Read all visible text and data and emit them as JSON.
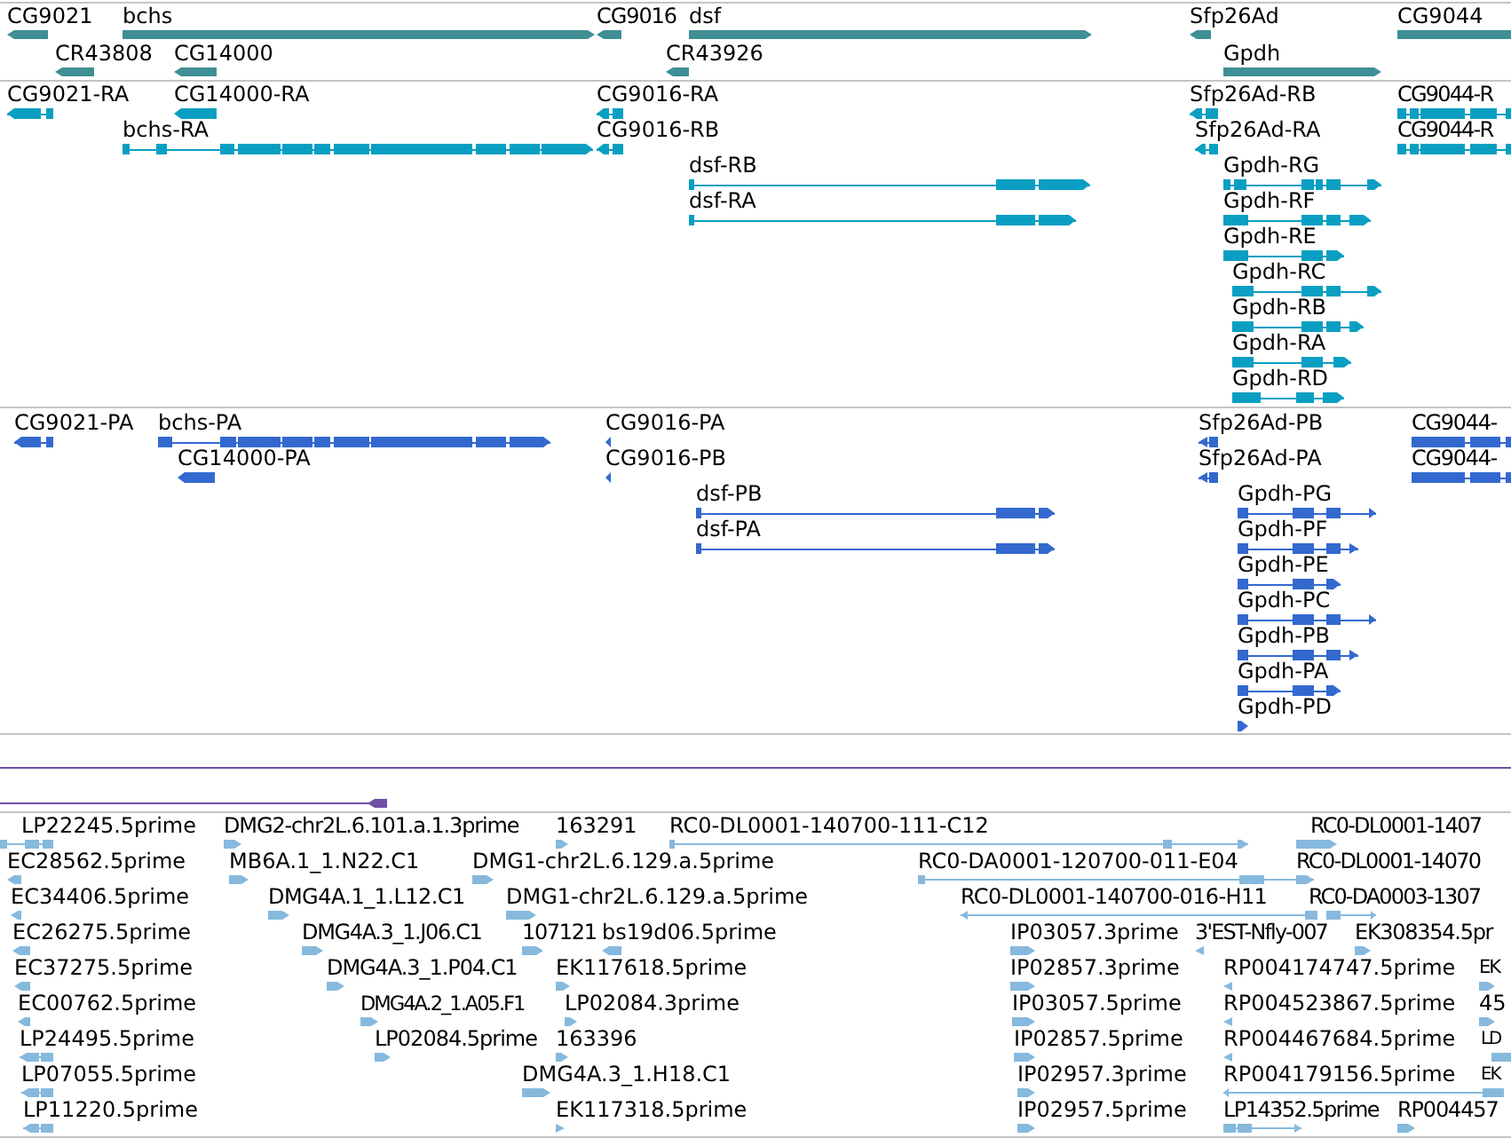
{
  "tracks": [
    {
      "kind": "gene",
      "features": [
        {
          "label": "CG9021",
          "reverse": true
        },
        {
          "label": "bchs",
          "reverse": false
        },
        {
          "label": "CG9016",
          "reverse": true
        },
        {
          "label": "dsf",
          "reverse": false
        },
        {
          "label": "Sfp26Ad",
          "reverse": true
        },
        {
          "label": "CG9044",
          "reverse": false
        },
        {
          "label": "CR43808",
          "reverse": true
        },
        {
          "label": "CG14000",
          "reverse": true
        },
        {
          "label": "CR43926",
          "reverse": true
        },
        {
          "label": "Gpdh",
          "reverse": false
        }
      ]
    },
    {
      "kind": "transcript",
      "features": [
        {
          "label": "CG9021-RA",
          "reverse": true
        },
        {
          "label": "CG14000-RA",
          "reverse": true
        },
        {
          "label": "CG9016-RA",
          "reverse": true
        },
        {
          "label": "Sfp26Ad-RB",
          "reverse": true
        },
        {
          "label": "CG9044-R",
          "reverse": false
        },
        {
          "label": "bchs-RA",
          "reverse": false
        },
        {
          "label": "CG9016-RB",
          "reverse": true
        },
        {
          "label": "Sfp26Ad-RA",
          "reverse": true
        },
        {
          "label": "CG9044-R",
          "reverse": false
        },
        {
          "label": "dsf-RB",
          "reverse": false
        },
        {
          "label": "Gpdh-RG",
          "reverse": false
        },
        {
          "label": "dsf-RA",
          "reverse": false
        },
        {
          "label": "Gpdh-RF",
          "reverse": false
        },
        {
          "label": "Gpdh-RE",
          "reverse": false
        },
        {
          "label": "Gpdh-RC",
          "reverse": false
        },
        {
          "label": "Gpdh-RB",
          "reverse": false
        },
        {
          "label": "Gpdh-RA",
          "reverse": false
        },
        {
          "label": "Gpdh-RD",
          "reverse": false
        }
      ]
    },
    {
      "kind": "protein",
      "features": [
        {
          "label": "CG9021-PA",
          "reverse": true
        },
        {
          "label": "bchs-PA",
          "reverse": false
        },
        {
          "label": "CG9016-PA",
          "reverse": true
        },
        {
          "label": "Sfp26Ad-PB",
          "reverse": true
        },
        {
          "label": "CG9044-",
          "reverse": false
        },
        {
          "label": "CG14000-PA",
          "reverse": true
        },
        {
          "label": "CG9016-PB",
          "reverse": true
        },
        {
          "label": "Sfp26Ad-PA",
          "reverse": true
        },
        {
          "label": "CG9044-",
          "reverse": false
        },
        {
          "label": "dsf-PB",
          "reverse": false
        },
        {
          "label": "Gpdh-PG",
          "reverse": false
        },
        {
          "label": "dsf-PA",
          "reverse": false
        },
        {
          "label": "Gpdh-PF",
          "reverse": false
        },
        {
          "label": "Gpdh-PE",
          "reverse": false
        },
        {
          "label": "Gpdh-PC",
          "reverse": false
        },
        {
          "label": "Gpdh-PB",
          "reverse": false
        },
        {
          "label": "Gpdh-PA",
          "reverse": false
        },
        {
          "label": "Gpdh-PD",
          "reverse": false
        }
      ]
    },
    {
      "kind": "line",
      "lines": [
        {
          "kind": "span"
        },
        {
          "kind": "segment"
        }
      ]
    },
    {
      "kind": "est",
      "features": [
        {
          "label": "LP22245.5prime",
          "reverse": true
        },
        {
          "label": "DMG2-chr2L.6.101.a.1.3prime",
          "reverse": false
        },
        {
          "label": "163291",
          "reverse": false
        },
        {
          "label": "RC0-DL0001-140700-111-C12",
          "reverse": false
        },
        {
          "label": "RC0-DL0001-1407",
          "reverse": false
        },
        {
          "label": "EC28562.5prime",
          "reverse": true
        },
        {
          "label": "MB6A.1_1.N22.C1",
          "reverse": false
        },
        {
          "label": "DMG1-chr2L.6.129.a.5prime",
          "reverse": false
        },
        {
          "label": "RC0-DA0001-120700-011-E04",
          "reverse": false
        },
        {
          "label": "RC0-DL0001-14070"
        },
        {
          "label": "EC34406.5prime",
          "reverse": true
        },
        {
          "label": "DMG4A.1_1.L12.C1",
          "reverse": false
        },
        {
          "label": "DMG1-chr2L.6.129.a.5prime",
          "reverse": false
        },
        {
          "label": "RC0-DL0001-140700-016-H11",
          "reverse": true
        },
        {
          "label": "RC0-DA0003-1307",
          "reverse": false
        },
        {
          "label": "EC26275.5prime",
          "reverse": true
        },
        {
          "label": "DMG4A.3_1.J06.C1",
          "reverse": false
        },
        {
          "label": "107121",
          "reverse": false
        },
        {
          "label": "bs19d06.5prime",
          "reverse": true
        },
        {
          "label": "IP03057.3prime",
          "reverse": false
        },
        {
          "label": "3'EST-Nfly-007",
          "reverse": true
        },
        {
          "label": "EK308354.5pr",
          "reverse": false
        },
        {
          "label": "EC37275.5prime",
          "reverse": true
        },
        {
          "label": "DMG4A.3_1.P04.C1",
          "reverse": false
        },
        {
          "label": "EK117618.5prime",
          "reverse": false
        },
        {
          "label": "IP02857.3prime",
          "reverse": false
        },
        {
          "label": "RP004174747.5prime",
          "reverse": true
        },
        {
          "label": "EK",
          "reverse": false
        },
        {
          "label": "EC00762.5prime",
          "reverse": true
        },
        {
          "label": "DMG4A.2_1.A05.F1",
          "reverse": false
        },
        {
          "label": "LP02084.3prime",
          "reverse": false
        },
        {
          "label": "IP03057.5prime",
          "reverse": false
        },
        {
          "label": "RP004523867.5prime",
          "reverse": true
        },
        {
          "label": "45",
          "reverse": false
        },
        {
          "label": "LP24495.5prime",
          "reverse": true
        },
        {
          "label": "LP02084.5prime",
          "reverse": false
        },
        {
          "label": "163396",
          "reverse": false
        },
        {
          "label": "IP02857.5prime",
          "reverse": false
        },
        {
          "label": "RP004467684.5prime",
          "reverse": true
        },
        {
          "label": "LD",
          "reverse": false
        },
        {
          "label": "LP07055.5prime",
          "reverse": true
        },
        {
          "label": "DMG4A.3_1.H18.C1",
          "reverse": false
        },
        {
          "label": "IP02957.3prime",
          "reverse": false
        },
        {
          "label": "RP004179156.5prime",
          "reverse": true
        },
        {
          "label": "EK"
        },
        {
          "label": "LP11220.5prime",
          "reverse": true
        },
        {
          "label": "EK117318.5prime",
          "reverse": false
        },
        {
          "label": "IP02957.5prime",
          "reverse": false
        },
        {
          "label": "LP14352.5prime",
          "reverse": false
        },
        {
          "label": "RP004457",
          "reverse": false
        }
      ]
    }
  ]
}
